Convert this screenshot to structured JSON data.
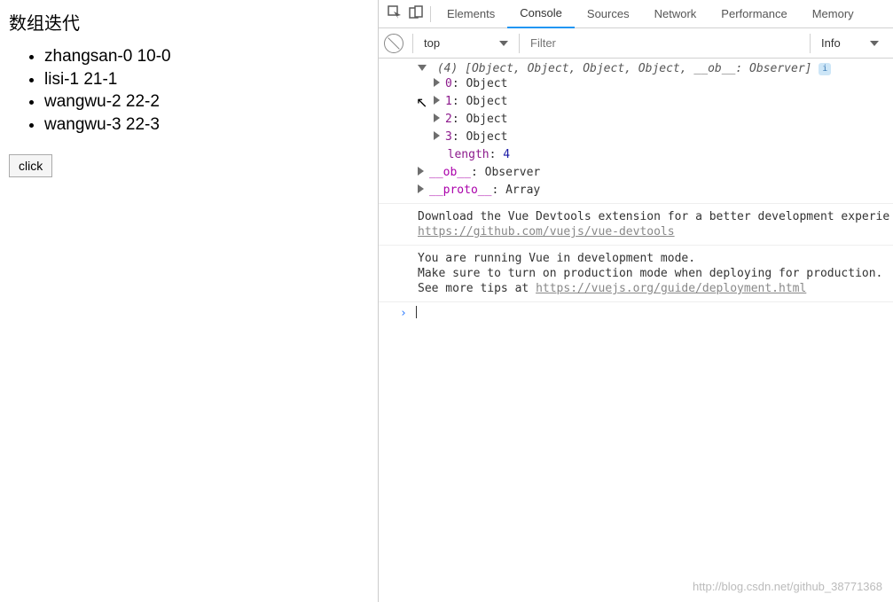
{
  "page": {
    "title": "数组迭代",
    "items": [
      "zhangsan-0 10-0",
      "lisi-1 21-1",
      "wangwu-2 22-2",
      "wangwu-3 22-3"
    ],
    "button": "click"
  },
  "devtools": {
    "tabs": [
      "Elements",
      "Console",
      "Sources",
      "Network",
      "Performance",
      "Memory"
    ],
    "active_tab": "Console",
    "context": "top",
    "filter_placeholder": "Filter",
    "level": "Info"
  },
  "console": {
    "array_header": "(4) [Object, Object, Object, Object, __ob__: Observer]",
    "children": [
      {
        "key": "0",
        "val": "Object"
      },
      {
        "key": "1",
        "val": "Object"
      },
      {
        "key": "2",
        "val": "Object"
      },
      {
        "key": "3",
        "val": "Object"
      }
    ],
    "length_key": "length",
    "length_val": "4",
    "ob_key": "__ob__",
    "ob_val": "Observer",
    "proto_key": "__proto__",
    "proto_val": "Array",
    "msg1_a": "Download the Vue Devtools extension for a better development experie",
    "msg1_link": "https://github.com/vuejs/vue-devtools",
    "msg2_a": "You are running Vue in development mode.",
    "msg2_b": "Make sure to turn on production mode when deploying for production.",
    "msg2_c": "See more tips at ",
    "msg2_link": "https://vuejs.org/guide/deployment.html",
    "prompt": "›"
  },
  "watermark": "http://blog.csdn.net/github_38771368"
}
